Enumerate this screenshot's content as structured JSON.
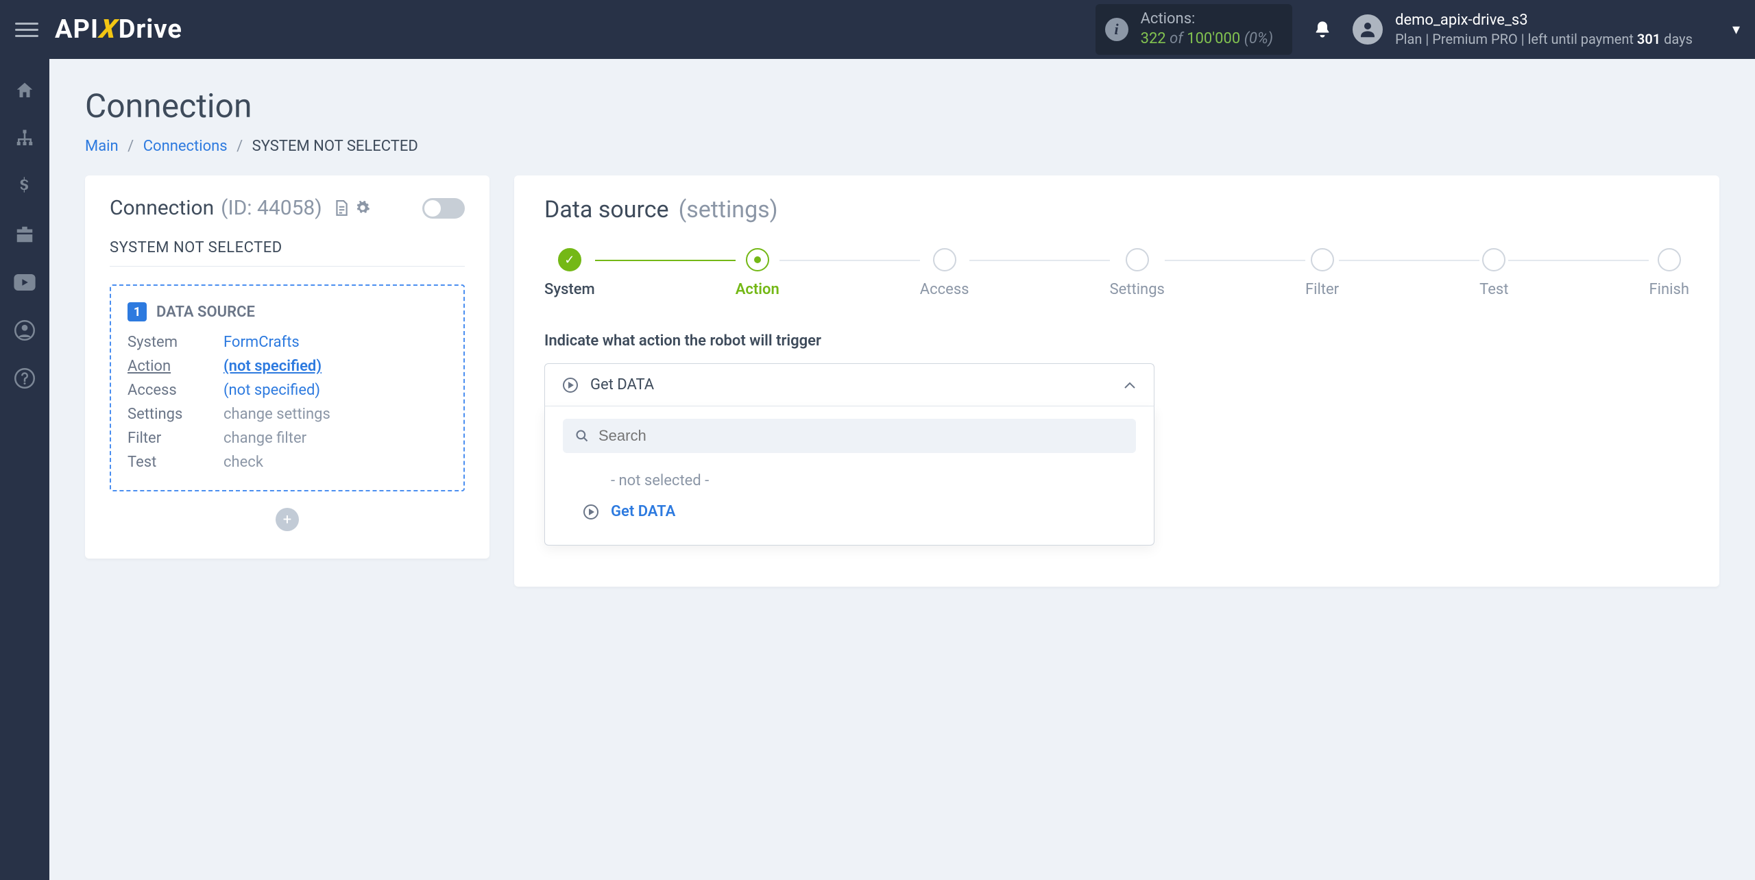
{
  "topbar": {
    "logo_api": "API",
    "logo_drive": "Drive",
    "actions_label": "Actions:",
    "actions_used": "322",
    "actions_of": "of",
    "actions_limit": "100'000",
    "actions_pct": "(0%)",
    "user_name": "demo_apix-drive_s3",
    "plan_prefix": "Plan |",
    "plan_name": "Premium PRO",
    "plan_mid": "| left until payment",
    "plan_days": "301",
    "plan_days_suffix": "days"
  },
  "page": {
    "title": "Connection",
    "crumb_main": "Main",
    "crumb_connections": "Connections",
    "crumb_current": "SYSTEM NOT SELECTED"
  },
  "left_card": {
    "title": "Connection",
    "id_label": "(ID: 44058)",
    "sub": "SYSTEM NOT SELECTED",
    "section_num": "1",
    "section_title": "DATA SOURCE",
    "rows": {
      "system_k": "System",
      "system_v": "FormCrafts",
      "action_k": "Action",
      "action_v": "(not specified)",
      "access_k": "Access",
      "access_v": "(not specified)",
      "settings_k": "Settings",
      "settings_v": "change settings",
      "filter_k": "Filter",
      "filter_v": "change filter",
      "test_k": "Test",
      "test_v": "check"
    }
  },
  "right_card": {
    "title": "Data source",
    "sub": "(settings)",
    "steps": [
      "System",
      "Action",
      "Access",
      "Settings",
      "Filter",
      "Test",
      "Finish"
    ],
    "prompt": "Indicate what action the robot will trigger",
    "selected": "Get DATA",
    "search_placeholder": "Search",
    "opt_none": "- not selected -",
    "opt_get": "Get DATA"
  }
}
